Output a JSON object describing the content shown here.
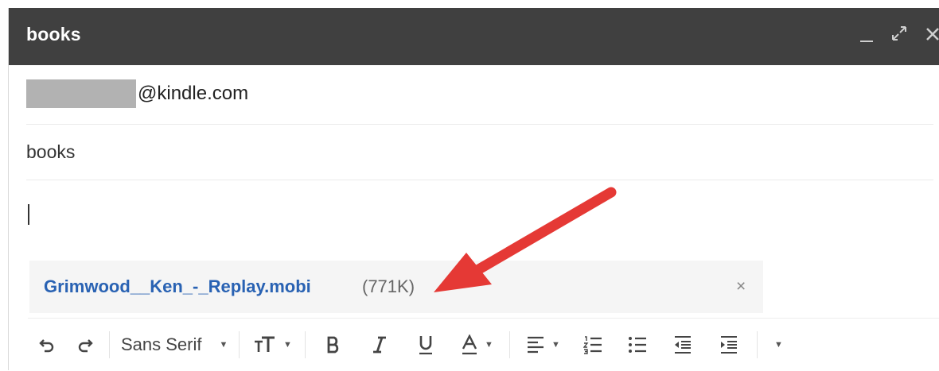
{
  "window": {
    "title": "books"
  },
  "recipient": {
    "address_suffix": "@kindle.com"
  },
  "subject": {
    "value": "books"
  },
  "attachment": {
    "filename": "Grimwood__Ken_-_Replay.mobi",
    "size": "(771K)",
    "remove_glyph": "×"
  },
  "toolbar": {
    "font_family": "Sans Serif",
    "buttons": [
      "undo-icon",
      "redo-icon",
      "font-size-icon",
      "bold-icon",
      "italic-icon",
      "underline-icon",
      "text-color-icon",
      "align-icon",
      "numbered-list-icon",
      "bulleted-list-icon",
      "indent-less-icon",
      "indent-more-icon",
      "more-options-icon"
    ]
  },
  "colors": {
    "titlebar": "#404040",
    "attachment_link": "#2962b3",
    "annotation_arrow": "#e53935"
  }
}
